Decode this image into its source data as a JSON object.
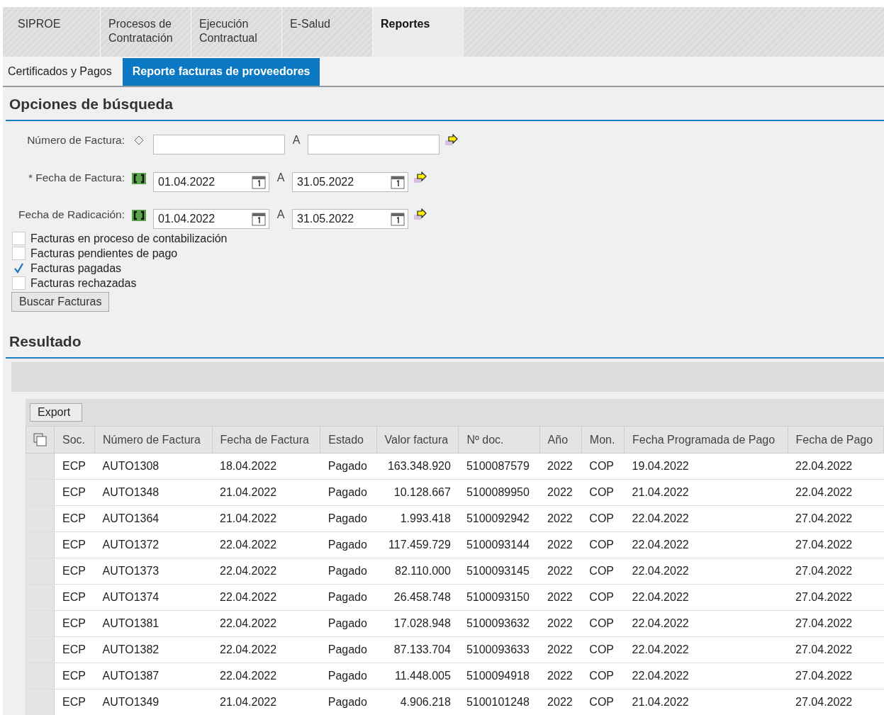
{
  "main_tabs": [
    {
      "label": "SIPROE",
      "selected": false
    },
    {
      "label": "Procesos de\nContratación",
      "selected": false
    },
    {
      "label": "Ejecución\nContractual",
      "selected": false
    },
    {
      "label": "E-Salud",
      "selected": false
    },
    {
      "label": "Reportes",
      "selected": true
    }
  ],
  "sub_tabs": [
    {
      "label": "Certificados y Pagos",
      "selected": false
    },
    {
      "label": "Reporte facturas de proveedores",
      "selected": true
    }
  ],
  "search_section": {
    "title": "Opciones de búsqueda",
    "fields": [
      {
        "label": "Número de Factura:",
        "kind": "text",
        "to_label": "A"
      },
      {
        "label": "* Fecha de Factura:",
        "kind": "date",
        "from": "01.04.2022",
        "to_label": "A",
        "to": "31.05.2022"
      },
      {
        "label": "Fecha de Radicación:",
        "kind": "date",
        "from": "01.04.2022",
        "to_label": "A",
        "to": "31.05.2022"
      }
    ],
    "checkboxes": [
      {
        "label": "Facturas en proceso de contabilización",
        "checked": false
      },
      {
        "label": "Facturas pendientes de pago",
        "checked": false
      },
      {
        "label": "Facturas pagadas",
        "checked": true
      },
      {
        "label": "Facturas rechazadas",
        "checked": false
      }
    ],
    "button": "Buscar Facturas"
  },
  "results_section": {
    "title": "Resultado",
    "export_button": "Export",
    "table": {
      "columns": [
        "Soc.",
        "Número de Factura",
        "Fecha de Factura",
        "Estado",
        "Valor factura",
        "Nº doc.",
        "Año",
        "Mon.",
        "Fecha Programada de Pago",
        "Fecha de Pago"
      ],
      "rows": [
        [
          "ECP",
          "AUTO1308",
          "18.04.2022",
          "Pagado",
          "163.348.920",
          "5100087579",
          "2022",
          "COP",
          "19.04.2022",
          "22.04.2022"
        ],
        [
          "ECP",
          "AUTO1348",
          "21.04.2022",
          "Pagado",
          "10.128.667",
          "5100089950",
          "2022",
          "COP",
          "21.04.2022",
          "22.04.2022"
        ],
        [
          "ECP",
          "AUTO1364",
          "21.04.2022",
          "Pagado",
          "1.993.418",
          "5100092942",
          "2022",
          "COP",
          "22.04.2022",
          "27.04.2022"
        ],
        [
          "ECP",
          "AUTO1372",
          "22.04.2022",
          "Pagado",
          "117.459.729",
          "5100093144",
          "2022",
          "COP",
          "22.04.2022",
          "27.04.2022"
        ],
        [
          "ECP",
          "AUTO1373",
          "22.04.2022",
          "Pagado",
          "82.110.000",
          "5100093145",
          "2022",
          "COP",
          "22.04.2022",
          "27.04.2022"
        ],
        [
          "ECP",
          "AUTO1374",
          "22.04.2022",
          "Pagado",
          "26.458.748",
          "5100093150",
          "2022",
          "COP",
          "22.04.2022",
          "27.04.2022"
        ],
        [
          "ECP",
          "AUTO1381",
          "22.04.2022",
          "Pagado",
          "17.028.948",
          "5100093632",
          "2022",
          "COP",
          "22.04.2022",
          "27.04.2022"
        ],
        [
          "ECP",
          "AUTO1382",
          "22.04.2022",
          "Pagado",
          "87.133.704",
          "5100093633",
          "2022",
          "COP",
          "22.04.2022",
          "27.04.2022"
        ],
        [
          "ECP",
          "AUTO1387",
          "22.04.2022",
          "Pagado",
          "11.448.005",
          "5100094918",
          "2022",
          "COP",
          "22.04.2022",
          "27.04.2022"
        ],
        [
          "ECP",
          "AUTO1349",
          "21.04.2022",
          "Pagado",
          "4.906.218",
          "5100101248",
          "2022",
          "COP",
          "21.04.2022",
          "27.04.2022"
        ]
      ]
    }
  }
}
